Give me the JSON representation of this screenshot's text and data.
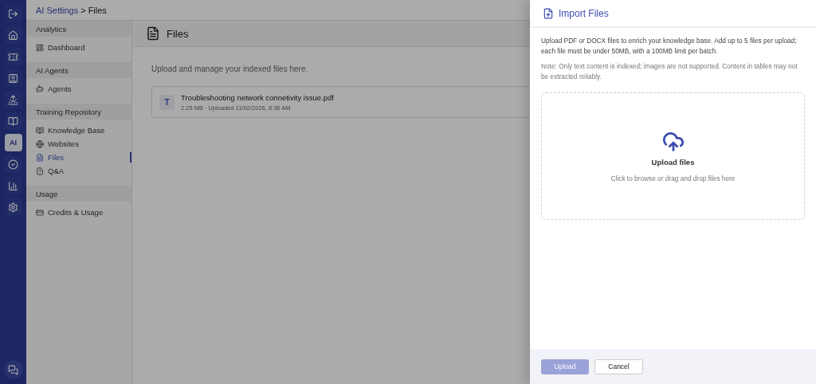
{
  "breadcrumb": {
    "parent": "AI Settings",
    "separator": ">",
    "current": "Files"
  },
  "rail": {
    "items": [
      {
        "kind": "exit",
        "selected": false
      },
      {
        "kind": "home",
        "selected": false
      },
      {
        "kind": "ticket",
        "selected": false
      },
      {
        "kind": "contact",
        "selected": false
      },
      {
        "kind": "sunrise",
        "selected": false
      },
      {
        "kind": "book",
        "selected": false
      },
      {
        "kind": "ai",
        "label": "AI",
        "selected": true
      },
      {
        "kind": "check",
        "selected": false
      },
      {
        "kind": "chart",
        "selected": false
      },
      {
        "kind": "settings",
        "selected": false
      }
    ],
    "bottom": {
      "kind": "chat"
    }
  },
  "sidebar": {
    "sections": [
      {
        "title": "Analytics",
        "items": [
          {
            "kind": "dashboard",
            "label": "Dashboard",
            "selected": false
          }
        ]
      },
      {
        "title": "AI Agents",
        "items": [
          {
            "kind": "agents",
            "label": "Agents",
            "selected": false
          }
        ]
      },
      {
        "title": "Training Repository",
        "items": [
          {
            "kind": "knowledge",
            "label": "Knowledge Base",
            "selected": false
          },
          {
            "kind": "globe",
            "label": "Websites",
            "selected": false
          },
          {
            "kind": "file",
            "label": "Files",
            "selected": true
          },
          {
            "kind": "qa",
            "label": "Q&A",
            "selected": false
          }
        ]
      },
      {
        "title": "Usage",
        "items": [
          {
            "kind": "credits",
            "label": "Credits & Usage",
            "selected": false
          }
        ]
      }
    ]
  },
  "main": {
    "title": "Files",
    "description": "Upload and manage your indexed files here.",
    "files": [
      {
        "initial": "T",
        "name": "Troubleshooting network connetivity issue.pdf",
        "meta": "2.25 MB · Uploaded 11/02/2026, 8:36 AM"
      }
    ]
  },
  "drawer": {
    "title": "Import Files",
    "description": "Upload PDF or DOCX files to enrich your knowledge base. Add up to 5 files per upload; each file must be under 50MB, with a 100MB limit per batch.",
    "note": "Note: Only text content is indexed; images are not supported. Content in tables may not be extracted reliably.",
    "dropzone": {
      "title": "Upload files",
      "hint": "Click to browse or drag and drop files here"
    },
    "buttons": [
      {
        "kind": "primary",
        "label": "Upload",
        "disabled": true
      },
      {
        "kind": "secondary",
        "label": "Cancel",
        "disabled": false
      }
    ]
  }
}
